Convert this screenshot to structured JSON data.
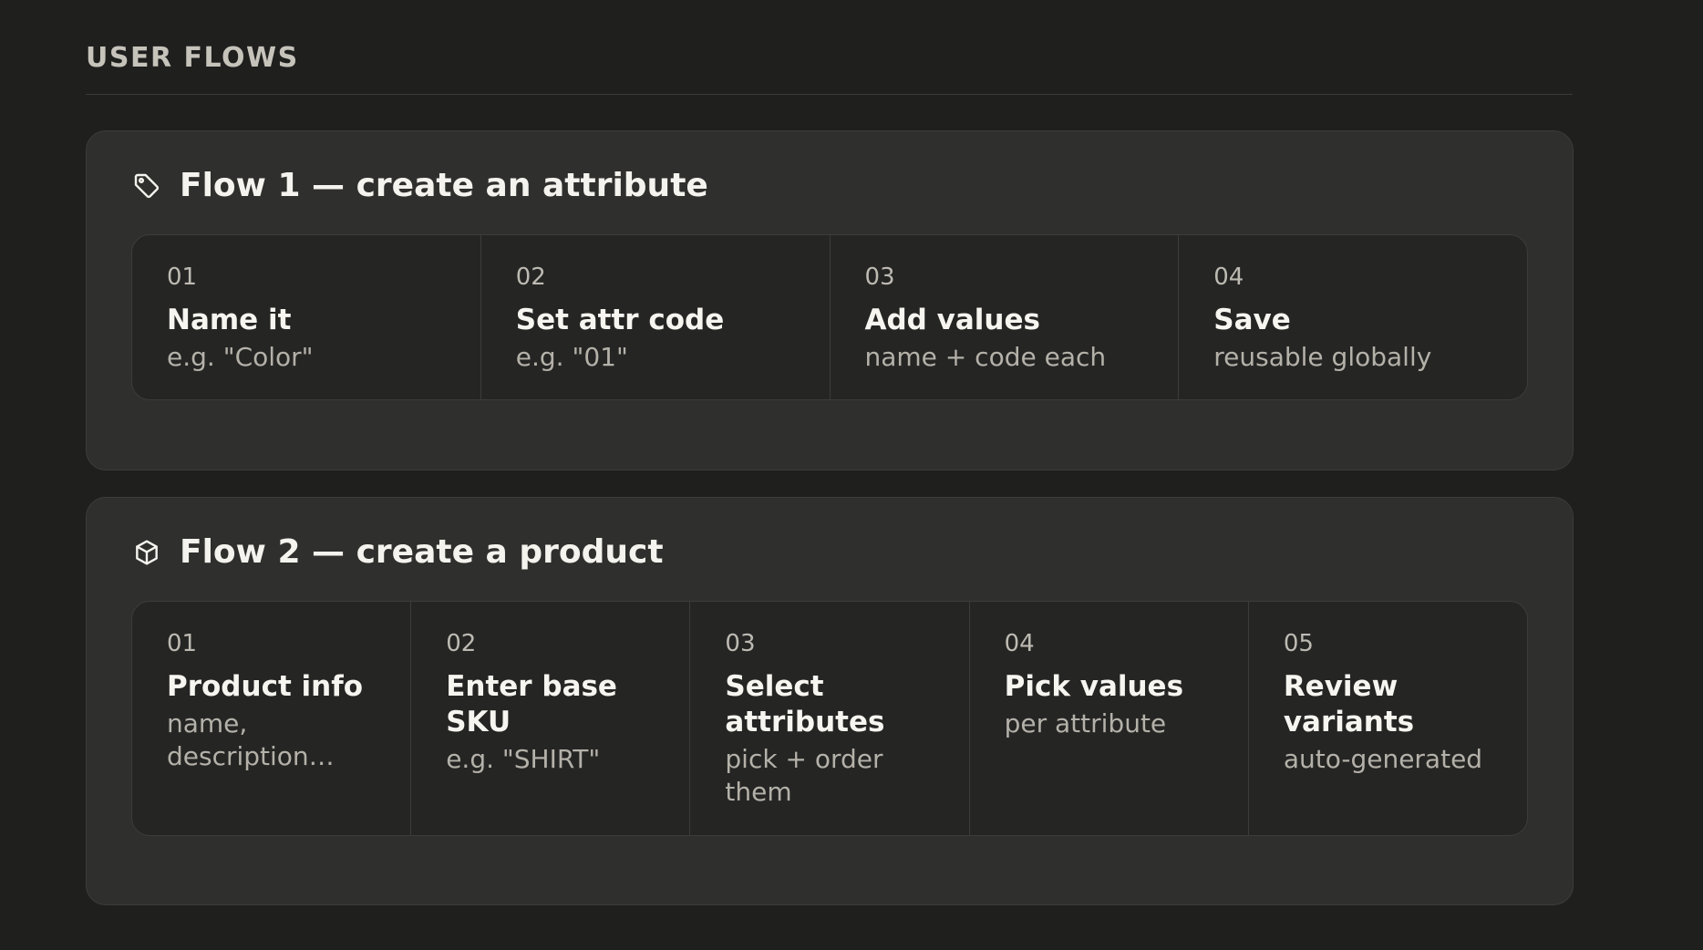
{
  "section": {
    "title": "USER FLOWS"
  },
  "flows": [
    {
      "title": "Flow 1 — create an attribute",
      "icon": "tag-icon",
      "steps": [
        {
          "num": "01",
          "title": "Name it",
          "desc": "e.g. \"Color\""
        },
        {
          "num": "02",
          "title": "Set attr code",
          "desc": "e.g. \"01\""
        },
        {
          "num": "03",
          "title": "Add values",
          "desc": "name + code each"
        },
        {
          "num": "04",
          "title": "Save",
          "desc": "reusable globally"
        }
      ]
    },
    {
      "title": "Flow 2 — create a product",
      "icon": "box-icon",
      "steps": [
        {
          "num": "01",
          "title": "Product info",
          "desc": "name, description…"
        },
        {
          "num": "02",
          "title": "Enter base SKU",
          "desc": "e.g. \"SHIRT\""
        },
        {
          "num": "03",
          "title": "Select attributes",
          "desc": "pick + order them"
        },
        {
          "num": "04",
          "title": "Pick values",
          "desc": "per attribute"
        },
        {
          "num": "05",
          "title": "Review variants",
          "desc": "auto-generated"
        }
      ]
    }
  ],
  "colors": {
    "background": "#1f1f1e",
    "card": "#2f2f2d",
    "steps_panel": "#252524",
    "border": "#3c3c3a",
    "text_primary": "#f4f3ee",
    "text_secondary": "#b4b1a9"
  }
}
